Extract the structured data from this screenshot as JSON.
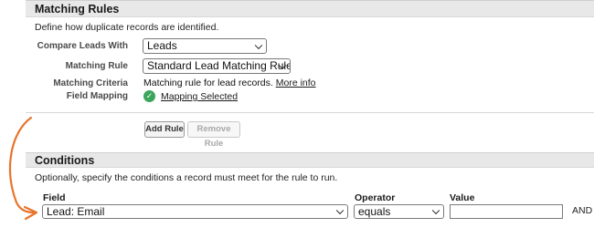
{
  "matching_rules": {
    "header": "Matching Rules",
    "description": "Define how duplicate records are identified.",
    "compare_leads_with": {
      "label": "Compare Leads With",
      "value": "Leads"
    },
    "matching_rule": {
      "label": "Matching Rule",
      "value": "Standard Lead Matching Rule"
    },
    "matching_criteria": {
      "label": "Matching Criteria",
      "text": "Matching rule for lead records.",
      "link": "More info"
    },
    "field_mapping": {
      "label": "Field Mapping",
      "link": "Mapping Selected"
    },
    "buttons": {
      "add_rule": "Add Rule",
      "remove_rule": "Remove Rule"
    }
  },
  "conditions": {
    "header": "Conditions",
    "description": "Optionally, specify the conditions a record must meet for the rule to run.",
    "columns": {
      "field": "Field",
      "operator": "Operator",
      "value": "Value"
    },
    "row": {
      "field": "Lead: Email",
      "operator": "equals",
      "value": "",
      "connector": "AND"
    }
  },
  "colors": {
    "arrow": "#e8742c",
    "check": "#3ba55c",
    "header_bg": "#e8e8e8"
  },
  "icons": {
    "check": "check-circle-icon",
    "arrow": "curved-arrow-icon"
  }
}
